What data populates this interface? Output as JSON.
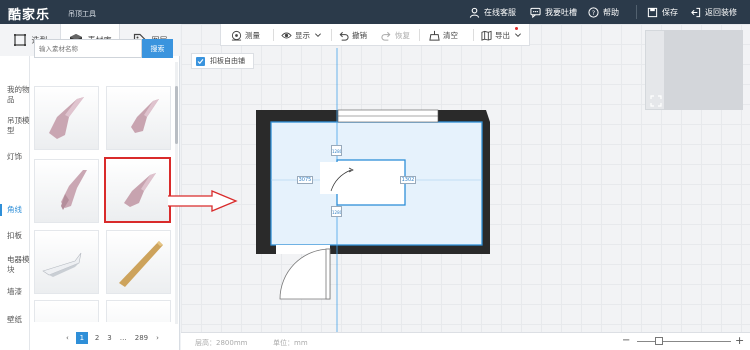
{
  "header": {
    "logo": "酷家乐",
    "product": "吊顶工具",
    "links": [
      {
        "label": "在线客服",
        "icon": "user-headset-icon"
      },
      {
        "label": "我要吐槽",
        "icon": "feedback-chat-icon"
      },
      {
        "label": "帮助",
        "icon": "help-circle-icon"
      },
      {
        "label": "保存",
        "icon": "save-icon"
      },
      {
        "label": "返回装修",
        "icon": "exit-icon"
      }
    ]
  },
  "left_panel": {
    "tabs": [
      {
        "label": "造型",
        "icon": "square-shape-icon",
        "active": false
      },
      {
        "label": "素材库",
        "icon": "cube-icon",
        "active": true
      },
      {
        "label": "图层",
        "icon": "tag-icon",
        "active": false
      }
    ],
    "categories": [
      {
        "label": "我的物品",
        "active": false
      },
      {
        "label": "吊顶模型",
        "active": false
      },
      {
        "label": "灯饰",
        "active": false
      },
      {
        "label": "角线",
        "active": true
      },
      {
        "label": "扣板",
        "active": false
      },
      {
        "label": "电器模块",
        "active": false
      },
      {
        "label": "墙漆",
        "active": false
      },
      {
        "label": "壁纸",
        "active": false
      }
    ],
    "search": {
      "placeholder": "输入素材名称",
      "button": "搜索"
    },
    "pagination": {
      "prev": "‹",
      "pages": [
        "1",
        "2",
        "3"
      ],
      "ellipsis": "…",
      "last": "289",
      "next": "›",
      "current": "1"
    }
  },
  "toolbar": {
    "items": [
      {
        "label": "测量",
        "icon": "measure-icon",
        "enabled": true
      },
      {
        "label": "显示",
        "icon": "eye-icon",
        "enabled": true
      },
      {
        "label": "撤销",
        "icon": "undo-icon",
        "enabled": true
      },
      {
        "label": "恢复",
        "icon": "redo-icon",
        "enabled": false
      },
      {
        "label": "清空",
        "icon": "broom-icon",
        "enabled": true
      },
      {
        "label": "导出",
        "icon": "map-export-icon",
        "enabled": true
      }
    ]
  },
  "canvas": {
    "checkbox_label": "扣板自由铺",
    "dimensions": {
      "top": "1280",
      "left": "3075",
      "right": "1302",
      "bottom": "1280"
    }
  },
  "statusbar": {
    "height_label": "层高：2800mm",
    "unit_label": "单位：mm"
  },
  "colors": {
    "accent": "#2f8fd8",
    "header_bg": "#2b3a4a",
    "selection": "#d92b2b",
    "room_fill": "#e6f2fc"
  }
}
